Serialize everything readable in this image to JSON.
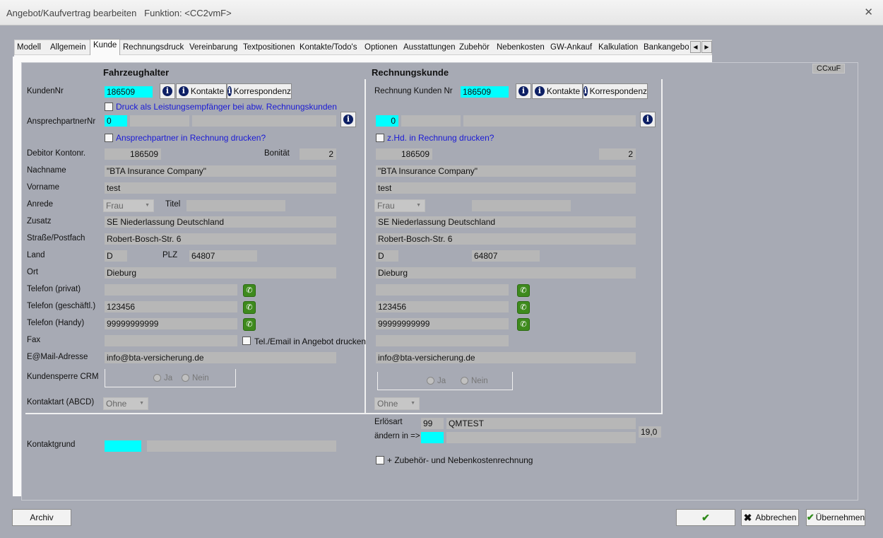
{
  "window": {
    "title": "Angebot/Kaufvertrag bearbeiten",
    "function": "Funktion: <CC2vmF>",
    "close_icon": "close-icon"
  },
  "tabs": [
    "Modell",
    "Allgemein",
    "Kunde",
    "Rechnungsdruck",
    "Vereinbarung",
    "Textpositionen",
    "Kontakte/Todo's",
    "Optionen",
    "Ausstattungen",
    "Zubehör",
    "Nebenkosten",
    "GW-Ankauf",
    "Kalkulation",
    "Bankangebot"
  ],
  "active_tab": "Kunde",
  "corner_code": "CCxuF",
  "left": {
    "heading": "Fahrzeughalter",
    "kunden_nr_label": "KundenNr",
    "kunden_nr": "186509",
    "kontakte_btn": "Kontakte",
    "korrespondenz_btn": "Korrespondenz",
    "druck_label": "Druck als Leistungsempfänger bei abw. Rechnungskunden",
    "ansprech_label": "AnsprechpartnerNr",
    "ansprech_value": "0",
    "ansprech_print": "Ansprechpartner in Rechnung drucken?",
    "debitor_label": "Debitor Kontonr.",
    "debitor": "186509",
    "bonitaet_label": "Bonität",
    "bonitaet": "2",
    "nachname_label": "Nachname",
    "nachname": "\"BTA  Insurance Company\"",
    "vorname_label": "Vorname",
    "vorname": "test",
    "anrede_label": "Anrede",
    "anrede": "Frau",
    "titel_label": "Titel",
    "titel": "",
    "zusatz_label": "Zusatz",
    "zusatz": "SE Niederlassung Deutschland",
    "strasse_label": "Straße/Postfach",
    "strasse": "Robert-Bosch-Str. 6",
    "land_label": "Land",
    "land": "D",
    "plz_label": "PLZ",
    "plz": "64807",
    "ort_label": "Ort",
    "ort": "Dieburg",
    "tel_privat_label": "Telefon (privat)",
    "tel_privat": "",
    "tel_gesch_label": "Telefon (geschäftl.)",
    "tel_gesch": "123456",
    "tel_handy_label": "Telefon (Handy)",
    "tel_handy": "99999999999",
    "fax_label": "Fax",
    "fax": "",
    "tel_email_print": "Tel./Email  in Angebot drucken",
    "email_label": "E@Mail-Adresse",
    "email": "info@bta-versicherung.de",
    "sperre_label": "Kundensperre CRM",
    "ja": "Ja",
    "nein": "Nein",
    "kontaktart_label": "Kontaktart (ABCD)",
    "kontaktart": "Ohne",
    "kontaktgrund_label": "Kontaktgrund"
  },
  "right": {
    "heading": "Rechnungskunde",
    "kunden_nr_label": "Rechnung Kunden Nr",
    "kunden_nr": "186509",
    "kontakte_btn": "Kontakte",
    "korrespondenz_btn": "Korrespondenz",
    "ansprech_value": "0",
    "zhd_print": "z.Hd. in Rechnung drucken?",
    "debitor": "186509",
    "bonitaet": "2",
    "nachname": "\"BTA  Insurance Company\"",
    "vorname": "test",
    "anrede": "Frau",
    "zusatz": "SE Niederlassung Deutschland",
    "strasse": "Robert-Bosch-Str. 6",
    "land": "D",
    "plz": "64807",
    "ort": "Dieburg",
    "tel_gesch": "123456",
    "tel_handy": "99999999999",
    "email": "info@bta-versicherung.de",
    "ja": "Ja",
    "nein": "Nein",
    "kontaktart": "Ohne",
    "erloesart_label": "Erlösart",
    "erloesart_code": "99",
    "erloesart_name": "QMTEST",
    "aendern_label": "ändern in =>",
    "steuer": "19,0",
    "zubehoer_label": "+ Zubehör- und Nebenkostenrechnung"
  },
  "footer": {
    "archiv": "Archiv",
    "ok": "",
    "abbrechen": "Abbrechen",
    "uebernehmen": "Übernehmen"
  }
}
